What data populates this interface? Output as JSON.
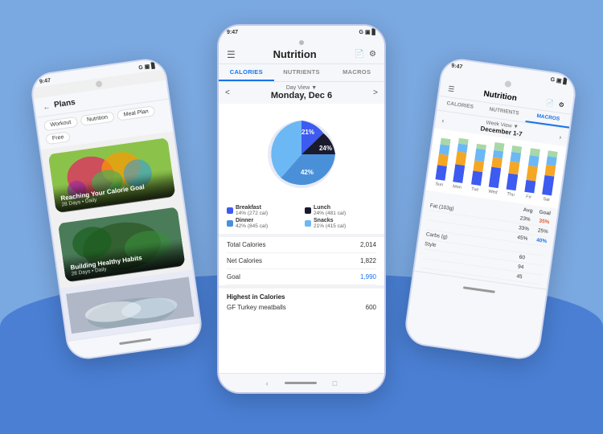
{
  "background": {
    "color": "#7aa8e0",
    "wave_color": "#4a7fd4"
  },
  "left_phone": {
    "status_bar": {
      "time": "9:47",
      "icons": "G ☰ •"
    },
    "header": {
      "back_label": "←",
      "title": "Plans"
    },
    "chips": [
      "Workout",
      "Nutrition",
      "Meal Plan",
      "Free"
    ],
    "cards": [
      {
        "title": "Reaching Your Calorie Goal",
        "subtitle": "28 Days • Daily"
      },
      {
        "title": "Building Healthy Habits",
        "subtitle": "28 Days • Daily"
      }
    ]
  },
  "center_phone": {
    "status_bar": {
      "time": "9:47",
      "icons": "G ☰ •"
    },
    "header": {
      "title": "Nutrition",
      "doc_icon": "📄",
      "gear_icon": "⚙"
    },
    "tabs": [
      "CALORIES",
      "NUTRIENTS",
      "MACROS"
    ],
    "active_tab": 0,
    "day_view": {
      "label": "Day View ▼",
      "date": "Monday, Dec 6",
      "nav_left": "<",
      "nav_right": ">"
    },
    "pie_chart": {
      "segments": [
        {
          "label": "Breakfast",
          "percent": 14,
          "calories": 272,
          "color": "#3d5af1"
        },
        {
          "label": "Lunch",
          "percent": 24,
          "calories": 481,
          "color": "#1a1a2e"
        },
        {
          "label": "Dinner",
          "percent": 42,
          "calories": 845,
          "color": "#4a90d9"
        },
        {
          "label": "Snacks",
          "percent": 21,
          "calories": 415,
          "color": "#6cb8f5"
        }
      ]
    },
    "stats": [
      {
        "label": "Total Calories",
        "value": "2,014",
        "is_goal": false
      },
      {
        "label": "Net Calories",
        "value": "1,822",
        "is_goal": false
      },
      {
        "label": "Goal",
        "value": "1,990",
        "is_goal": true
      }
    ],
    "highest": {
      "title": "Highest in Calories",
      "item": "GF Turkey meatballs",
      "value": "600"
    }
  },
  "right_phone": {
    "status_bar": {
      "time": "9:47",
      "icons": "G ☰ •"
    },
    "header": {
      "title": "Nutrition"
    },
    "tabs": [
      "CALORIES",
      "NUTRIENTS",
      "MACROS"
    ],
    "active_tab": 2,
    "week_view": {
      "label": "Week View ▼",
      "date": "December 1-7"
    },
    "chart": {
      "days": [
        "Sun",
        "Mon",
        "Tue",
        "Wed",
        "Thu",
        "Fri",
        "Sat"
      ],
      "bars": [
        [
          30,
          25,
          20,
          15
        ],
        [
          35,
          28,
          18,
          12
        ],
        [
          28,
          22,
          25,
          10
        ],
        [
          40,
          20,
          15,
          18
        ],
        [
          32,
          26,
          20,
          14
        ],
        [
          25,
          30,
          22,
          16
        ],
        [
          38,
          22,
          18,
          12
        ]
      ],
      "colors": [
        "#3d5af1",
        "#f5a623",
        "#6cb8f5",
        "#a8d8a8"
      ]
    },
    "stats_table": {
      "headers": [
        "Avg",
        "Goal"
      ],
      "rows": [
        {
          "label": "Fat (103g)",
          "avg": "23%",
          "goal": "35%",
          "goal_highlight": true
        },
        {
          "label": "",
          "avg": "33%",
          "goal": "25%",
          "avg_highlight": false
        },
        {
          "label": "",
          "avg": "45%",
          "goal": "40%",
          "blue": true
        },
        {
          "label": "Carbs (g)",
          "avg": "",
          "goal": ""
        },
        {
          "label": "Style",
          "avg": "60",
          "goal": ""
        },
        {
          "label": "",
          "avg": "94",
          "goal": ""
        },
        {
          "label": "",
          "avg": "45",
          "goal": ""
        }
      ]
    }
  }
}
